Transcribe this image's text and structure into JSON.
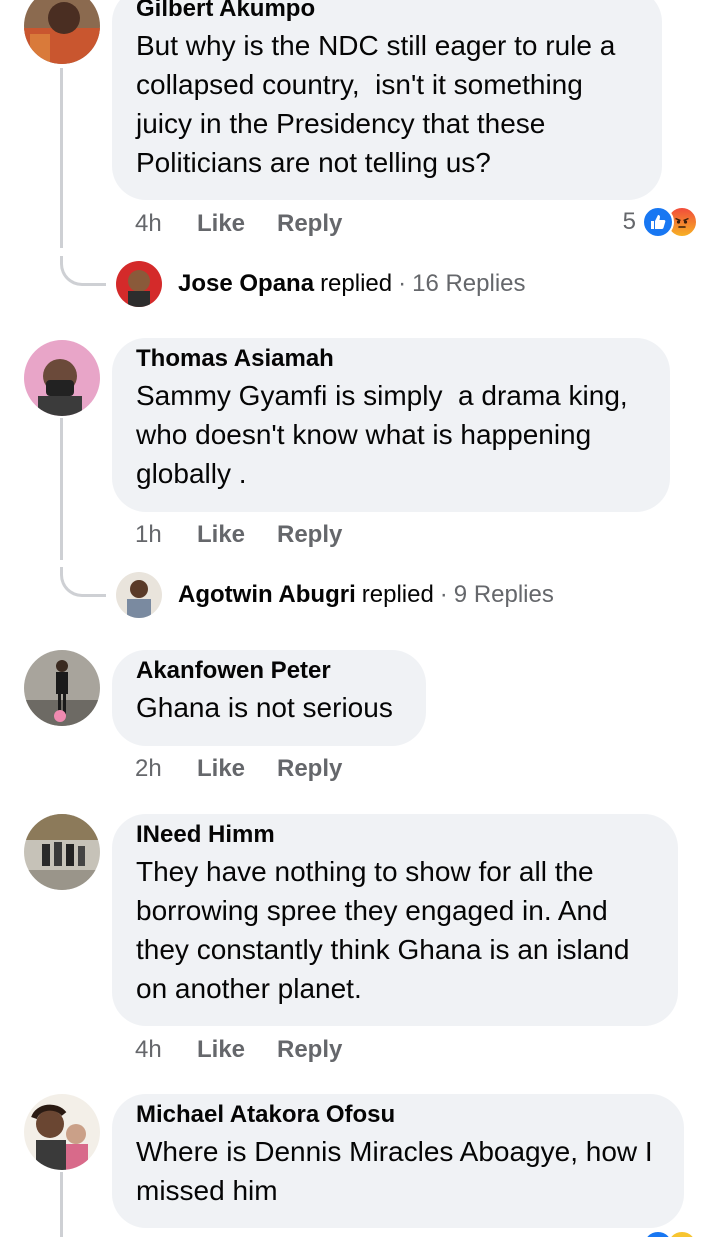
{
  "comments": [
    {
      "author": "Gilbert Akumpo",
      "text": "But why is the NDC still eager to rule a collapsed country,  isn't it something juicy in the Presidency that these Politicians are not telling us?",
      "time": "4h",
      "like_label": "Like",
      "reply_label": "Reply",
      "reaction_count": "5",
      "reactions": [
        "like-icon",
        "angry-icon"
      ],
      "replies": {
        "name": "Jose Opana",
        "verb": "replied",
        "count": "16 Replies"
      }
    },
    {
      "author": "Thomas Asiamah",
      "text": "Sammy Gyamfi is simply  a drama king, who doesn't know what is happening globally .",
      "time": "1h",
      "like_label": "Like",
      "reply_label": "Reply",
      "replies": {
        "name": "Agotwin Abugri",
        "verb": "replied",
        "count": "9 Replies"
      }
    },
    {
      "author": "Akanfowen Peter",
      "text": "Ghana is not serious",
      "time": "2h",
      "like_label": "Like",
      "reply_label": "Reply"
    },
    {
      "author": "INeed Himm",
      "text": "They have nothing to show for all the borrowing spree they engaged in. And they constantly think Ghana is an island on another planet.",
      "time": "4h",
      "like_label": "Like",
      "reply_label": "Reply"
    },
    {
      "author": "Michael Atakora Ofosu",
      "text": "Where is Dennis Miracles Aboagye, how I missed him"
    }
  ],
  "colors": {
    "bubble": "#f0f2f5",
    "meta": "#65676b",
    "like_blue": "#1877f2"
  }
}
